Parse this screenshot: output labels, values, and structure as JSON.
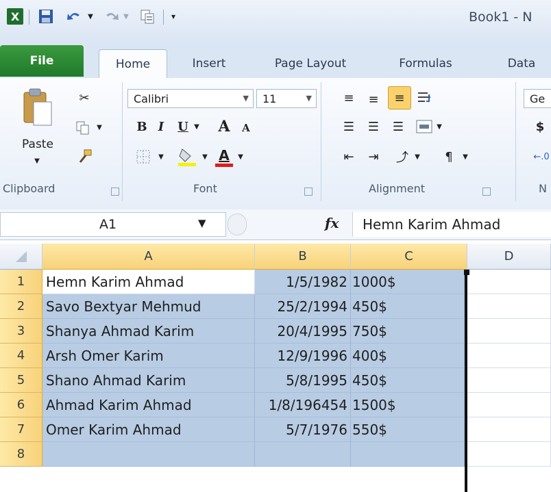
{
  "window": {
    "title": "Book1 - N"
  },
  "quick_access": {
    "icons": [
      "excel-app-icon",
      "save-icon",
      "undo-icon",
      "redo-icon",
      "copy-icon",
      "customize-qat-icon"
    ]
  },
  "tabs": [
    "File",
    "Home",
    "Insert",
    "Page Layout",
    "Formulas",
    "Data"
  ],
  "ribbon": {
    "clipboard": {
      "paste_label": "Paste",
      "group_label": "Clipboard"
    },
    "font": {
      "name": "Calibri",
      "size": "11",
      "bold": "B",
      "italic": "I",
      "underline": "U",
      "grow": "A",
      "shrink": "A",
      "font_color": "A",
      "group_label": "Font"
    },
    "alignment": {
      "group_label": "Alignment"
    },
    "number": {
      "format_partial": "Ge",
      "currency": "$",
      "group_label_partial": "N"
    }
  },
  "formula_bar": {
    "name_box": "A1",
    "fx": "fx",
    "formula": "Hemn Karim Ahmad"
  },
  "grid": {
    "columns": [
      "A",
      "B",
      "C",
      "D"
    ],
    "rows": [
      {
        "num": "1",
        "a": "Hemn Karim Ahmad",
        "b": "1/5/1982",
        "c": "1000$"
      },
      {
        "num": "2",
        "a": "Savo Bextyar Mehmud",
        "b": "25/2/1994",
        "c": "450$"
      },
      {
        "num": "3",
        "a": "Shanya Ahmad Karim",
        "b": "20/4/1995",
        "c": "750$"
      },
      {
        "num": "4",
        "a": "Arsh Omer Karim",
        "b": "12/9/1996",
        "c": "400$"
      },
      {
        "num": "5",
        "a": "Shano Ahmad Karim",
        "b": "5/8/1995",
        "c": "450$"
      },
      {
        "num": "6",
        "a": "Ahmad Karim Ahmad",
        "b": "1/8/196454",
        "c": "1500$"
      },
      {
        "num": "7",
        "a": "Omer Karim Ahmad",
        "b": "5/7/1976",
        "c": "550$"
      },
      {
        "num": "8",
        "a": "",
        "b": "",
        "c": ""
      }
    ]
  },
  "colors": {
    "file_tab": "#1f7a2a",
    "selection": "#b8cce4",
    "header_highlight": "#f8d27a"
  }
}
